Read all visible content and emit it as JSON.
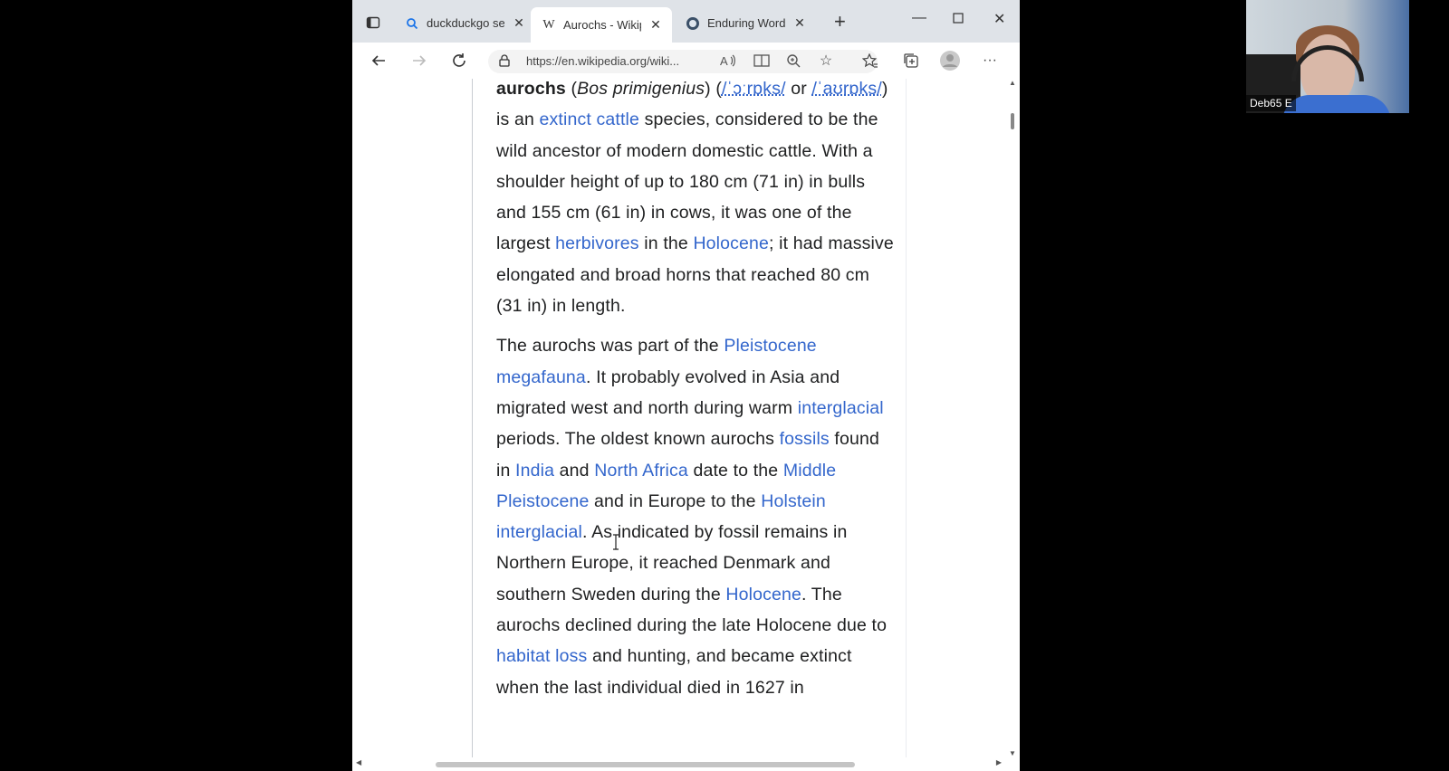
{
  "tabs": [
    {
      "title": "duckduckgo sea",
      "favicon": "duckduckgo-icon",
      "active": false
    },
    {
      "title": "Aurochs - Wikip",
      "favicon": "wikipedia-icon",
      "active": true
    },
    {
      "title": "Enduring Word B",
      "favicon": "enduring-word-icon",
      "active": false
    }
  ],
  "address": {
    "url": "https://en.wikipedia.org/wiki..."
  },
  "article": {
    "p1": {
      "bold": "aurochs",
      "t1": " (",
      "italic": "Bos primigenius",
      "t2": ") (",
      "ipa1": "/ˈɔːrɒks/",
      "t3": " or ",
      "ipa2": "/ˈaʊrɒks/",
      "t4": ") is an ",
      "link_extinct": "extinct",
      "t5": " ",
      "link_cattle": "cattle",
      "t6": " species, considered to be the wild ancestor of modern domestic cattle. With a shoulder height of up to 180 cm (71 in) in bulls and 155 cm (61 in) in cows, it was one of the largest ",
      "link_herbivores": "herbivores",
      "t7": " in the ",
      "link_holocene": "Holocene",
      "t8": "; it had massive elongated and broad horns that reached 80 cm (31 in) in length."
    },
    "p2": {
      "t1": "The aurochs was part of the ",
      "link_pleistocene_megafauna": "Pleistocene megafauna",
      "t2": ". It probably evolved in Asia and migrated west and north during warm ",
      "link_interglacial": "interglacial",
      "t3": " periods. The oldest known aurochs ",
      "link_fossils": "fossils",
      "t4": " found in ",
      "link_india": "India",
      "t5": " and ",
      "link_north_africa": "North Africa",
      "t6": " date to the ",
      "link_middle_pleistocene": "Middle Pleistocene",
      "t7": " and in Europe to the ",
      "link_holstein": "Holstein interglacial",
      "t8": ". As indicated by fossil remains in Northern Europe, it reached Denmark and southern Sweden during the ",
      "link_holocene": "Holocene",
      "t9": ". The aurochs declined during the late Holocene due to ",
      "link_habitat_loss": "habitat loss",
      "t10": " and hunting, and became extinct when the last individual died in 1627 in"
    }
  },
  "webcam": {
    "name": "Deb65 E"
  }
}
